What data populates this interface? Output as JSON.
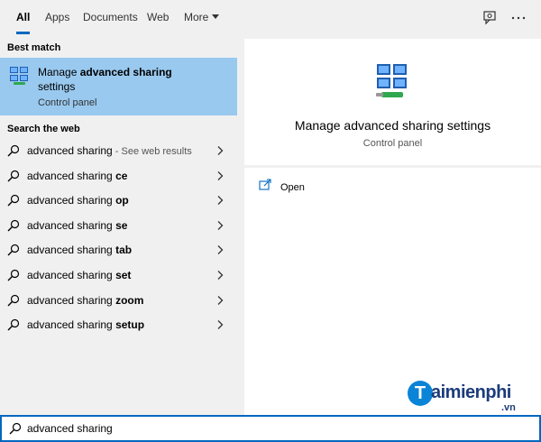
{
  "tabs": [
    {
      "label": "All",
      "active": true
    },
    {
      "label": "Apps"
    },
    {
      "label": "Documents"
    },
    {
      "label": "Web"
    },
    {
      "label": "More"
    }
  ],
  "top_icons": [
    "feedback-icon",
    "more-options-icon"
  ],
  "best_match": {
    "heading": "Best match",
    "title_prefix": "Manage ",
    "title_bold": "advanced sharing",
    "title_suffix": "settings",
    "subtitle": "Control panel",
    "icon": "network-sharing-icon"
  },
  "web": {
    "heading": "Search the web",
    "items": [
      {
        "base": "advanced sharing",
        "suffix": "",
        "see_more": " - See web results"
      },
      {
        "base": "advanced sharing ",
        "suffix": "ce",
        "see_more": ""
      },
      {
        "base": "advanced sharing ",
        "suffix": "op",
        "see_more": ""
      },
      {
        "base": "advanced sharing ",
        "suffix": "se",
        "see_more": ""
      },
      {
        "base": "advanced sharing ",
        "suffix": "tab",
        "see_more": ""
      },
      {
        "base": "advanced sharing ",
        "suffix": "set",
        "see_more": ""
      },
      {
        "base": "advanced sharing ",
        "suffix": "zoom",
        "see_more": ""
      },
      {
        "base": "advanced sharing ",
        "suffix": "setup",
        "see_more": ""
      }
    ]
  },
  "preview": {
    "title": "Manage advanced sharing settings",
    "subtitle": "Control panel",
    "actions": [
      {
        "label": "Open",
        "icon": "open-icon"
      }
    ]
  },
  "watermark": {
    "letter": "T",
    "text": "aimienphi",
    "suffix": ".vn"
  },
  "search": {
    "value": "advanced sharing",
    "placeholder": ""
  },
  "colors": {
    "accent": "#0067c0",
    "selection": "#99c9ef",
    "background": "#f0f0f0"
  }
}
